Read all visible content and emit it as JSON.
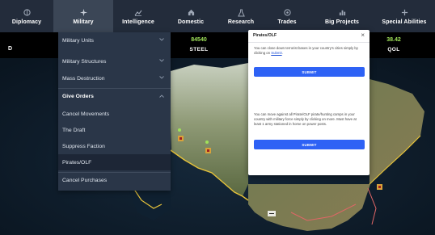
{
  "nav": {
    "tabs": [
      {
        "label": "Diplomacy",
        "icon": "diplomacy-icon"
      },
      {
        "label": "Military",
        "icon": "military-icon"
      },
      {
        "label": "Intelligence",
        "icon": "chart-icon"
      },
      {
        "label": "Domestic",
        "icon": "home-icon"
      },
      {
        "label": "Research",
        "icon": "flask-icon"
      },
      {
        "label": "Trades",
        "icon": "trades-icon"
      },
      {
        "label": "Big Projects",
        "icon": "bar-chart-icon"
      },
      {
        "label": "Special Abilities",
        "icon": "plus-icon"
      }
    ],
    "active_tab": "Military"
  },
  "resources": {
    "left_fragment": "D",
    "steel": {
      "value": "84540",
      "label": "STEEL"
    },
    "qol": {
      "value": "38.42",
      "label": "QOL"
    }
  },
  "menu": {
    "items": [
      {
        "label": "Military Units",
        "has_chevron": true
      },
      {
        "label": "Military Structures",
        "has_chevron": true
      },
      {
        "label": "Mass Destruction",
        "has_chevron": true
      },
      {
        "label": "Give Orders",
        "has_chevron": true,
        "header": true
      },
      {
        "label": "Cancel Movements"
      },
      {
        "label": "The Draft"
      },
      {
        "label": "Suppress Faction"
      },
      {
        "label": "Pirates/OLF",
        "selected": true
      },
      {
        "label": "Cancel Purchases"
      }
    ]
  },
  "dialog": {
    "title": "Pirates/OLF",
    "close": "×",
    "text1_prefix": "You can close down terrorist bases in your country's cities simply by clicking on ",
    "text1_link": "Submit",
    "text1_suffix": ".",
    "submit1": "SUBMIT",
    "text2": "You can move against all Pirate/OLF pirate/hunting camps in your country with military force simply by clicking on  more. Must have at least 1 army stationed in home on power posts.",
    "submit2": "SUBMIT"
  },
  "colors": {
    "nav_bg": "#232c3b",
    "nav_active": "#3b4656",
    "menu_bg": "#2a3648",
    "resource_value": "#a0e35a",
    "submit_button": "#2e62f5"
  }
}
